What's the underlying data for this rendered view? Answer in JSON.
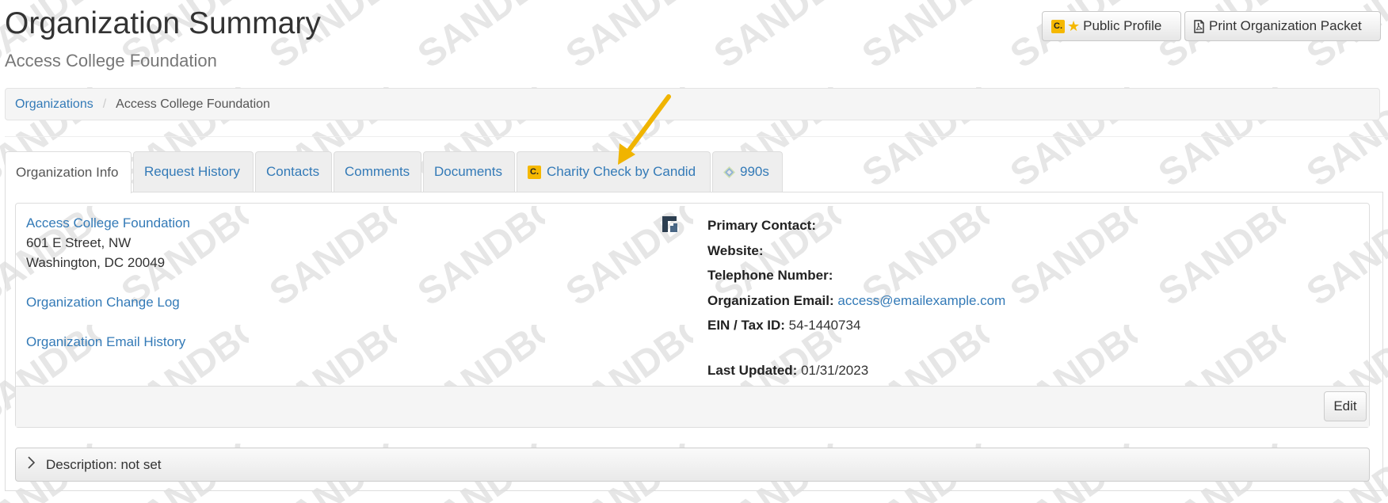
{
  "header": {
    "title": "Organization Summary",
    "subtitle": "Access College Foundation",
    "public_profile_badge": "C.",
    "public_profile_label": "Public Profile",
    "print_packet_label": "Print Organization Packet"
  },
  "breadcrumb": {
    "root": "Organizations",
    "separator": "/",
    "current": "Access College Foundation"
  },
  "tabs": [
    {
      "label": "Organization Info",
      "active": true
    },
    {
      "label": "Request History"
    },
    {
      "label": "Contacts"
    },
    {
      "label": "Comments"
    },
    {
      "label": "Documents"
    },
    {
      "label": "Charity Check by Candid",
      "badge": "C."
    },
    {
      "label": "990s"
    }
  ],
  "org": {
    "name": "Access College Foundation",
    "address_line1": "601 E Street, NW",
    "address_line2": "Washington, DC 20049",
    "change_log_link": "Organization Change Log",
    "email_history_link": "Organization Email History"
  },
  "details": {
    "primary_contact_label": "Primary Contact:",
    "website_label": "Website:",
    "telephone_label": "Telephone Number:",
    "email_label": "Organization Email:",
    "email_value": "access@emailexample.com",
    "ein_label": "EIN / Tax ID:",
    "ein_value": "54-1440734",
    "last_updated_label": "Last Updated:",
    "last_updated_value": "01/31/2023"
  },
  "edit_label": "Edit",
  "description_label": "Description: not set",
  "watermark_text": "SANDBOX",
  "colors": {
    "link": "#337ab7",
    "candid_badge": "#f5b800",
    "arrow": "#f0b400"
  }
}
